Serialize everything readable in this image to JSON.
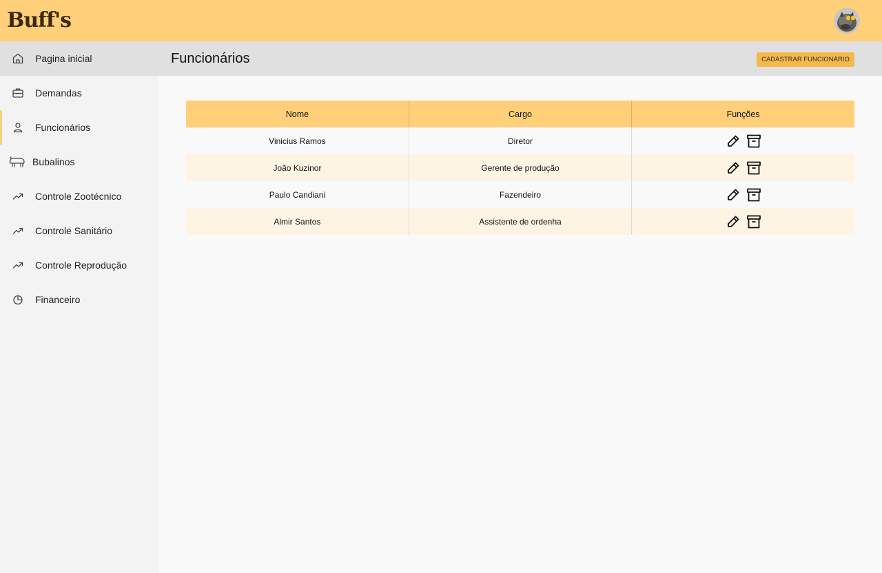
{
  "app": {
    "logo_text": "Buff's"
  },
  "sidebar": {
    "items": [
      {
        "label": "Pagina inicial",
        "icon": "home-icon"
      },
      {
        "label": "Demandas",
        "icon": "briefcase-icon"
      },
      {
        "label": "Funcionários",
        "icon": "user-icon"
      },
      {
        "label": "Bubalinos",
        "icon": "buffalo-icon"
      },
      {
        "label": "Controle Zootécnico",
        "icon": "trending-up-icon"
      },
      {
        "label": "Controle Sanitário",
        "icon": "trending-up-icon"
      },
      {
        "label": "Controle Reprodução",
        "icon": "trending-up-icon"
      },
      {
        "label": "Financeiro",
        "icon": "pie-chart-icon"
      }
    ],
    "active_index": 2
  },
  "header": {
    "title": "Funcionários",
    "add_button_label": "CADASTRAR FUNCIONÁRIO"
  },
  "table": {
    "columns": [
      "Nome",
      "Cargo",
      "Funções"
    ],
    "rows": [
      {
        "nome": "Vinicius Ramos",
        "cargo": "Diretor"
      },
      {
        "nome": "João Kuzinor",
        "cargo": "Gerente de produção"
      },
      {
        "nome": "Paulo Candiani",
        "cargo": "Fazendeiro"
      },
      {
        "nome": "Almir Santos",
        "cargo": "Assistente de ordenha"
      }
    ],
    "row_actions": [
      "edit-icon",
      "archive-icon"
    ]
  },
  "colors": {
    "topbar": "#ffcf7a",
    "accent_button": "#f5b94a",
    "row_stripe": "#fef4e3",
    "sidebar_bg": "#f3f3f3",
    "header_bg": "#e0e0e0"
  }
}
